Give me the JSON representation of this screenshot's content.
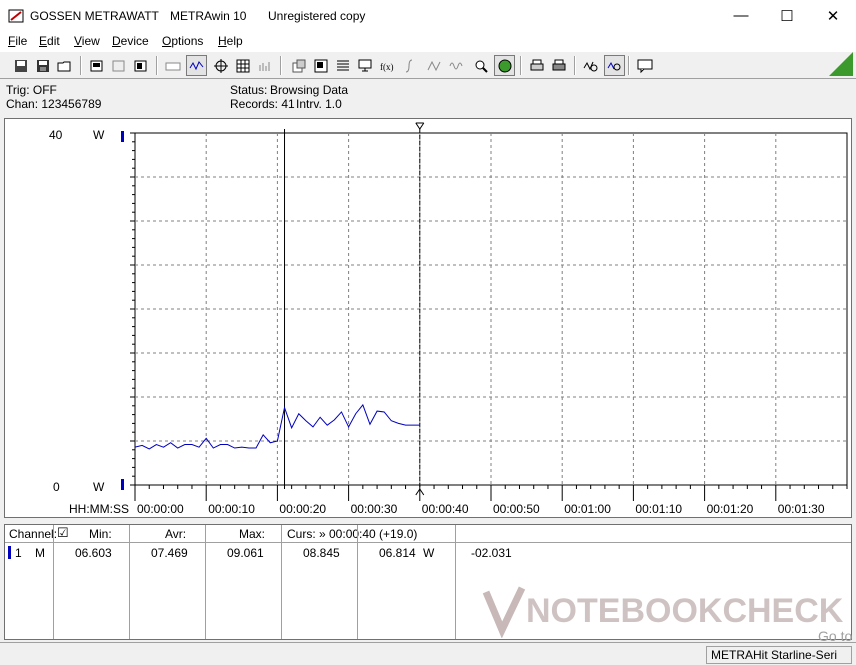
{
  "window": {
    "title_company": "GOSSEN METRAWATT",
    "title_app": "METRAwin 10",
    "title_license": "Unregistered copy",
    "minimize": "—",
    "maximize": "☐",
    "close": "✕"
  },
  "menu": [
    {
      "label": "File"
    },
    {
      "label": "Edit"
    },
    {
      "label": "View"
    },
    {
      "label": "Device"
    },
    {
      "label": "Options"
    },
    {
      "label": "Help"
    }
  ],
  "status": {
    "trig": "Trig: OFF",
    "chan": "Chan:  123456789",
    "status_label": "Status:",
    "status_value": "Browsing Data",
    "records": "Records: 41",
    "interval": "Intrv. 1.0"
  },
  "chart_data": {
    "type": "line",
    "ylim": [
      0,
      40
    ],
    "y_top_label": "40",
    "y_bottom_label": "0",
    "y_unit_top": "W",
    "y_unit_bottom": "W",
    "x_axis_label": "HH:MM:SS",
    "xlim": [
      0,
      100
    ],
    "x_ticks": [
      {
        "t": 0,
        "label": "00:00:00"
      },
      {
        "t": 10,
        "label": "00:00:10"
      },
      {
        "t": 20,
        "label": "00:00:20"
      },
      {
        "t": 30,
        "label": "00:00:30"
      },
      {
        "t": 40,
        "label": "00:00:40"
      },
      {
        "t": 50,
        "label": "00:00:50"
      },
      {
        "t": 60,
        "label": "00:01:00"
      },
      {
        "t": 70,
        "label": "00:01:10"
      },
      {
        "t": 80,
        "label": "00:01:20"
      },
      {
        "t": 90,
        "label": "00:01:30"
      }
    ],
    "cursor_1": 21,
    "cursor_2": 40,
    "series": [
      {
        "color": "#0000c0",
        "x": [
          0,
          1,
          2,
          3,
          4,
          5,
          6,
          7,
          8,
          9,
          10,
          11,
          12,
          13,
          14,
          15,
          16,
          17,
          18,
          19,
          20,
          21,
          22,
          23,
          24,
          25,
          26,
          27,
          28,
          29,
          30,
          31,
          32,
          33,
          34,
          35,
          36,
          37,
          38,
          39,
          40
        ],
        "y": [
          4.3,
          4.5,
          4.1,
          4.6,
          4.3,
          4.8,
          4.2,
          4.6,
          4.6,
          4.3,
          5.3,
          4.2,
          4.6,
          4.6,
          4.2,
          4.3,
          4.2,
          4.2,
          5.7,
          4.8,
          5.0,
          8.8,
          6.5,
          8.1,
          7.3,
          6.6,
          7.7,
          6.8,
          7.4,
          8.3,
          6.6,
          8.1,
          9.1,
          6.9,
          8.4,
          8.3,
          7.3,
          7.0,
          6.8,
          6.8,
          6.8
        ]
      }
    ]
  },
  "channel_grid": {
    "headers": {
      "channel": "Channel:",
      "check": "☑",
      "min": "Min:",
      "avr": "Avr:",
      "max": "Max:",
      "curs": "Curs: » 00:00:40 (+19.0)"
    },
    "row": {
      "num": "1",
      "mode": "M",
      "min": "06.603",
      "avr": "07.469",
      "max": "09.061",
      "curs1": "08.845",
      "curs2": "06.814",
      "unit": "W",
      "diff": "-02.031"
    }
  },
  "statusbar": {
    "device": "METRAHit Starline-Seri"
  },
  "watermark": {
    "text": "NOTEBOOKCHECK",
    "goto": "Go to"
  },
  "colors": {
    "series": "#0000c0",
    "corner_accent": "#3c9a2c",
    "watermark": "#b8a8a8"
  }
}
